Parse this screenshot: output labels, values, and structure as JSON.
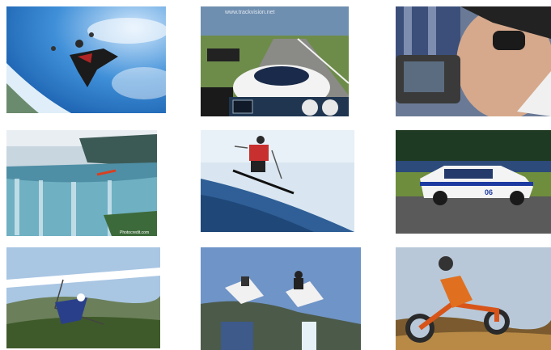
{
  "gallery": {
    "tiles": [
      {
        "id": "wingsuit-skydiver"
      },
      {
        "id": "race-car-cockpit",
        "watermark": "www.trackvision.net"
      },
      {
        "id": "cameraman-headset"
      },
      {
        "id": "niagara-falls-kayaker"
      },
      {
        "id": "skier-jump"
      },
      {
        "id": "mustang-race-car",
        "number": "06"
      },
      {
        "id": "hang-glider"
      },
      {
        "id": "snowmobile-jump"
      },
      {
        "id": "motocross-jump"
      }
    ]
  },
  "colors": {
    "sky_blue": "#2e7fd0",
    "background": "#ffffff"
  }
}
